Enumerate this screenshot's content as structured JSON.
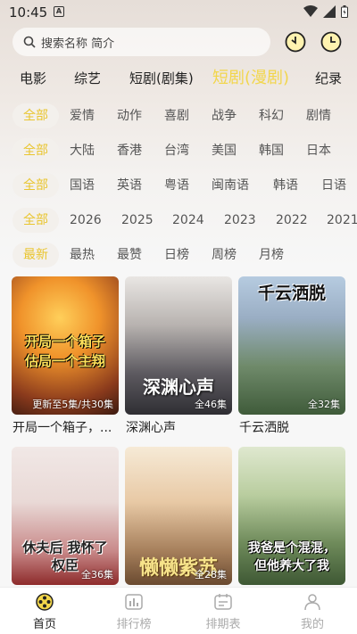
{
  "status": {
    "time": "10:45",
    "notif": "A"
  },
  "search": {
    "placeholder": "搜索名称 简介"
  },
  "header": {
    "history_icon": "clock-download-icon",
    "recent_icon": "clock-icon"
  },
  "category_tabs": [
    {
      "label": "电影",
      "active": false
    },
    {
      "label": "综艺",
      "active": false
    },
    {
      "label": "短剧(剧集)",
      "active": false
    },
    {
      "label": "短剧(漫剧)",
      "active": true
    },
    {
      "label": "纪录",
      "active": false
    }
  ],
  "filters": {
    "genre": [
      "全部",
      "爱情",
      "动作",
      "喜剧",
      "战争",
      "科幻",
      "剧情"
    ],
    "region": [
      "全部",
      "大陆",
      "香港",
      "台湾",
      "美国",
      "韩国",
      "日本"
    ],
    "language": [
      "全部",
      "国语",
      "英语",
      "粤语",
      "闽南语",
      "韩语",
      "日语"
    ],
    "year": [
      "全部",
      "2026",
      "2025",
      "2024",
      "2023",
      "2022",
      "2021"
    ],
    "sort": [
      "最新",
      "最热",
      "最赞",
      "日榜",
      "周榜",
      "月榜"
    ]
  },
  "cards": [
    {
      "title": "开局一个箱子，...",
      "badge": "更新至5集/共30集",
      "poster_text": "开局一个箱子 估局一个主翔",
      "colors": [
        "#f2a93b",
        "#8a3a1c"
      ]
    },
    {
      "title": "深渊心声",
      "badge": "全46集",
      "poster_text": "深渊心声",
      "colors": [
        "#d9d6d4",
        "#4b4a4f"
      ]
    },
    {
      "title": "千云洒脱",
      "badge": "全32集",
      "poster_text": "千云洒脱",
      "colors": [
        "#9fb7cf",
        "#3f5b3a"
      ]
    },
    {
      "title": "",
      "badge": "全36集",
      "poster_text": "休夫后 我怀了权臣",
      "colors": [
        "#f4ecea",
        "#b33a3a"
      ]
    },
    {
      "title": "",
      "badge": "全28集",
      "poster_text": "懒懒紫苏",
      "colors": [
        "#f5e4c8",
        "#7a5a3a"
      ]
    },
    {
      "title": "",
      "badge": "",
      "poster_text": "我爸是个混混，但他养大了我",
      "colors": [
        "#c9d8b4",
        "#4e6a42"
      ]
    }
  ],
  "nav": [
    {
      "label": "首页",
      "icon": "film-reel-icon",
      "active": true
    },
    {
      "label": "排行榜",
      "icon": "bar-chart-icon",
      "active": false
    },
    {
      "label": "排期表",
      "icon": "calendar-icon",
      "active": false
    },
    {
      "label": "我的",
      "icon": "user-icon",
      "active": false
    }
  ]
}
